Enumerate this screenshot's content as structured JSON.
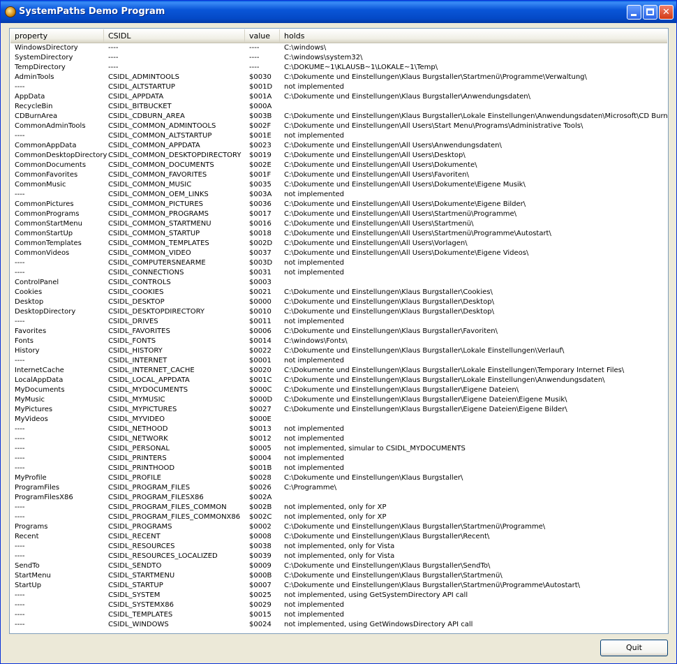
{
  "window": {
    "title": "SystemPaths Demo Program"
  },
  "columns": [
    "property",
    "CSIDL",
    "value",
    "holds"
  ],
  "rows": [
    [
      "WindowsDirectory",
      "----",
      "----",
      "C:\\windows\\"
    ],
    [
      "SystemDirectory",
      "----",
      "----",
      "C:\\windows\\system32\\"
    ],
    [
      "TempDirectory",
      "----",
      "----",
      "C:\\DOKUME~1\\KLAUSB~1\\LOKALE~1\\Temp\\"
    ],
    [
      "AdminTools",
      "CSIDL_ADMINTOOLS",
      "$0030",
      "C:\\Dokumente und Einstellungen\\Klaus Burgstaller\\Startmenü\\Programme\\Verwaltung\\"
    ],
    [
      "----",
      "CSIDL_ALTSTARTUP",
      "$001D",
      "not implemented"
    ],
    [
      "AppData",
      "CSIDL_APPDATA",
      "$001A",
      "C:\\Dokumente und Einstellungen\\Klaus Burgstaller\\Anwendungsdaten\\"
    ],
    [
      "RecycleBin",
      "CSIDL_BITBUCKET",
      "$000A",
      ""
    ],
    [
      "CDBurnArea",
      "CSIDL_CDBURN_AREA",
      "$003B",
      "C:\\Dokumente und Einstellungen\\Klaus Burgstaller\\Lokale Einstellungen\\Anwendungsdaten\\Microsoft\\CD Burning\\"
    ],
    [
      "CommonAdminTools",
      "CSIDL_COMMON_ADMINTOOLS",
      "$002F",
      "C:\\Dokumente und Einstellungen\\All Users\\Start Menu\\Programs\\Administrative Tools\\"
    ],
    [
      "----",
      "CSIDL_COMMON_ALTSTARTUP",
      "$001E",
      "not implemented"
    ],
    [
      "CommonAppData",
      "CSIDL_COMMON_APPDATA",
      "$0023",
      "C:\\Dokumente und Einstellungen\\All Users\\Anwendungsdaten\\"
    ],
    [
      "CommonDesktopDirectory",
      "CSIDL_COMMON_DESKTOPDIRECTORY",
      "$0019",
      "C:\\Dokumente und Einstellungen\\All Users\\Desktop\\"
    ],
    [
      "CommonDocuments",
      "CSIDL_COMMON_DOCUMENTS",
      "$002E",
      "C:\\Dokumente und Einstellungen\\All Users\\Dokumente\\"
    ],
    [
      "CommonFavorites",
      "CSIDL_COMMON_FAVORITES",
      "$001F",
      "C:\\Dokumente und Einstellungen\\All Users\\Favoriten\\"
    ],
    [
      "CommonMusic",
      "CSIDL_COMMON_MUSIC",
      "$0035",
      "C:\\Dokumente und Einstellungen\\All Users\\Dokumente\\Eigene Musik\\"
    ],
    [
      "----",
      "CSIDL_COMMON_OEM_LINKS",
      "$003A",
      "not implemented"
    ],
    [
      "CommonPictures",
      "CSIDL_COMMON_PICTURES",
      "$0036",
      "C:\\Dokumente und Einstellungen\\All Users\\Dokumente\\Eigene Bilder\\"
    ],
    [
      "CommonPrograms",
      "CSIDL_COMMON_PROGRAMS",
      "$0017",
      "C:\\Dokumente und Einstellungen\\All Users\\Startmenü\\Programme\\"
    ],
    [
      "CommonStartMenu",
      "CSIDL_COMMON_STARTMENU",
      "$0016",
      "C:\\Dokumente und Einstellungen\\All Users\\Startmenü\\"
    ],
    [
      "CommonStartUp",
      "CSIDL_COMMON_STARTUP",
      "$0018",
      "C:\\Dokumente und Einstellungen\\All Users\\Startmenü\\Programme\\Autostart\\"
    ],
    [
      "CommonTemplates",
      "CSIDL_COMMON_TEMPLATES",
      "$002D",
      "C:\\Dokumente und Einstellungen\\All Users\\Vorlagen\\"
    ],
    [
      "CommonVideos",
      "CSIDL_COMMON_VIDEO",
      "$0037",
      "C:\\Dokumente und Einstellungen\\All Users\\Dokumente\\Eigene Videos\\"
    ],
    [
      "----",
      "CSIDL_COMPUTERSNEARME",
      "$003D",
      "not implemented"
    ],
    [
      "----",
      "CSIDL_CONNECTIONS",
      "$0031",
      "not implemented"
    ],
    [
      "ControlPanel",
      "CSIDL_CONTROLS",
      "$0003",
      ""
    ],
    [
      "Cookies",
      "CSIDL_COOKIES",
      "$0021",
      "C:\\Dokumente und Einstellungen\\Klaus Burgstaller\\Cookies\\"
    ],
    [
      "Desktop",
      "CSIDL_DESKTOP",
      "$0000",
      "C:\\Dokumente und Einstellungen\\Klaus Burgstaller\\Desktop\\"
    ],
    [
      "DesktopDirectory",
      "CSIDL_DESKTOPDIRECTORY",
      "$0010",
      "C:\\Dokumente und Einstellungen\\Klaus Burgstaller\\Desktop\\"
    ],
    [
      "----",
      "CSIDL_DRIVES",
      "$0011",
      "not implemented"
    ],
    [
      "Favorites",
      "CSIDL_FAVORITES",
      "$0006",
      "C:\\Dokumente und Einstellungen\\Klaus Burgstaller\\Favoriten\\"
    ],
    [
      "Fonts",
      "CSIDL_FONTS",
      "$0014",
      "C:\\windows\\Fonts\\"
    ],
    [
      "History",
      "CSIDL_HISTORY",
      "$0022",
      "C:\\Dokumente und Einstellungen\\Klaus Burgstaller\\Lokale Einstellungen\\Verlauf\\"
    ],
    [
      "----",
      "CSIDL_INTERNET",
      "$0001",
      "not implemented"
    ],
    [
      "InternetCache",
      "CSIDL_INTERNET_CACHE",
      "$0020",
      "C:\\Dokumente und Einstellungen\\Klaus Burgstaller\\Lokale Einstellungen\\Temporary Internet Files\\"
    ],
    [
      "LocalAppData",
      "CSIDL_LOCAL_APPDATA",
      "$001C",
      "C:\\Dokumente und Einstellungen\\Klaus Burgstaller\\Lokale Einstellungen\\Anwendungsdaten\\"
    ],
    [
      "MyDocuments",
      "CSIDL_MYDOCUMENTS",
      "$000C",
      "C:\\Dokumente und Einstellungen\\Klaus Burgstaller\\Eigene Dateien\\"
    ],
    [
      "MyMusic",
      "CSIDL_MYMUSIC",
      "$000D",
      "C:\\Dokumente und Einstellungen\\Klaus Burgstaller\\Eigene Dateien\\Eigene Musik\\"
    ],
    [
      "MyPictures",
      "CSIDL_MYPICTURES",
      "$0027",
      "C:\\Dokumente und Einstellungen\\Klaus Burgstaller\\Eigene Dateien\\Eigene Bilder\\"
    ],
    [
      "MyVideos",
      "CSIDL_MYVIDEO",
      "$000E",
      ""
    ],
    [
      "----",
      "CSIDL_NETHOOD",
      "$0013",
      "not implemented"
    ],
    [
      "----",
      "CSIDL_NETWORK",
      "$0012",
      "not implemented"
    ],
    [
      "----",
      "CSIDL_PERSONAL",
      "$0005",
      "not implemented, simular to CSIDL_MYDOCUMENTS"
    ],
    [
      "----",
      "CSIDL_PRINTERS",
      "$0004",
      "not implemented"
    ],
    [
      "----",
      "CSIDL_PRINTHOOD",
      "$001B",
      "not implemented"
    ],
    [
      "MyProfile",
      "CSIDL_PROFILE",
      "$0028",
      "C:\\Dokumente und Einstellungen\\Klaus Burgstaller\\"
    ],
    [
      "ProgramFiles",
      "CSIDL_PROGRAM_FILES",
      "$0026",
      "C:\\Programme\\"
    ],
    [
      "ProgramFilesX86",
      "CSIDL_PROGRAM_FILESX86",
      "$002A",
      ""
    ],
    [
      "----",
      "CSIDL_PROGRAM_FILES_COMMON",
      "$002B",
      "not implemented, only for XP"
    ],
    [
      "----",
      "CSIDL_PROGRAM_FILES_COMMONX86",
      "$002C",
      "not implemented, only for XP"
    ],
    [
      "Programs",
      "CSIDL_PROGRAMS",
      "$0002",
      "C:\\Dokumente und Einstellungen\\Klaus Burgstaller\\Startmenü\\Programme\\"
    ],
    [
      "Recent",
      "CSIDL_RECENT",
      "$0008",
      "C:\\Dokumente und Einstellungen\\Klaus Burgstaller\\Recent\\"
    ],
    [
      "----",
      "CSIDL_RESOURCES",
      "$0038",
      "not implemented, only for Vista"
    ],
    [
      "----",
      "CSIDL_RESOURCES_LOCALIZED",
      "$0039",
      "not implemented, only for Vista"
    ],
    [
      "SendTo",
      "CSIDL_SENDTO",
      "$0009",
      "C:\\Dokumente und Einstellungen\\Klaus Burgstaller\\SendTo\\"
    ],
    [
      "StartMenu",
      "CSIDL_STARTMENU",
      "$000B",
      "C:\\Dokumente und Einstellungen\\Klaus Burgstaller\\Startmenü\\"
    ],
    [
      "StartUp",
      "CSIDL_STARTUP",
      "$0007",
      "C:\\Dokumente und Einstellungen\\Klaus Burgstaller\\Startmenü\\Programme\\Autostart\\"
    ],
    [
      "----",
      "CSIDL_SYSTEM",
      "$0025",
      "not implemented, using GetSystemDirectory API call"
    ],
    [
      "----",
      "CSIDL_SYSTEMX86",
      "$0029",
      "not implemented"
    ],
    [
      "----",
      "CSIDL_TEMPLATES",
      "$0015",
      "not implemented"
    ],
    [
      "----",
      "CSIDL_WINDOWS",
      "$0024",
      "not implemented, using GetWindowsDirectory API call"
    ]
  ],
  "buttons": {
    "quit": "Quit"
  },
  "colors": {
    "titlebar": "#0a56d8",
    "face": "#ece9d8",
    "list_border": "#7f9db9"
  }
}
